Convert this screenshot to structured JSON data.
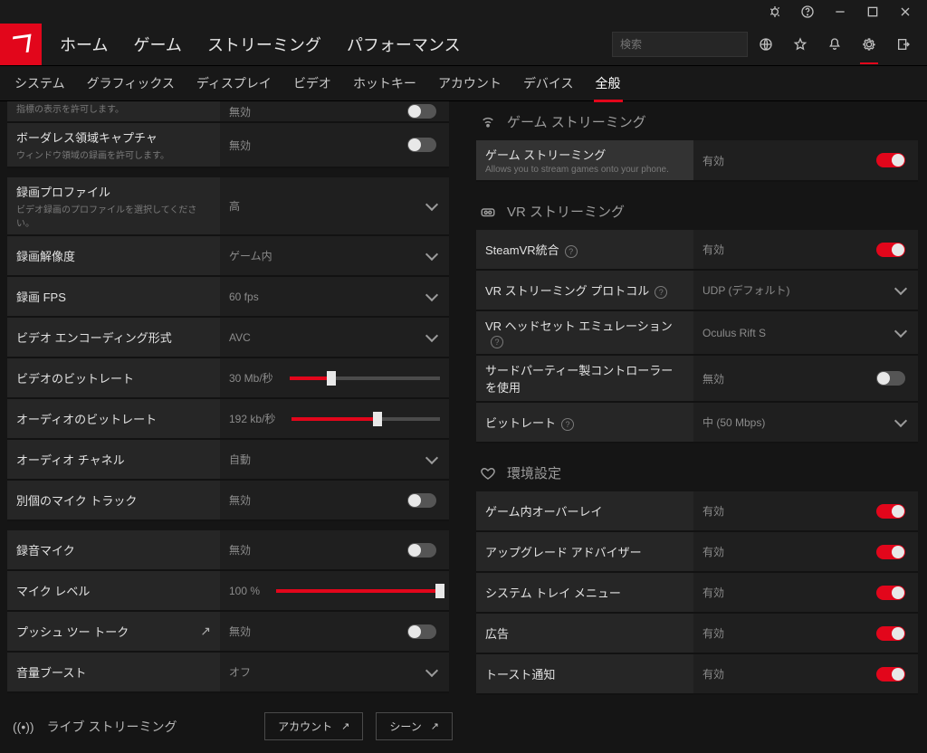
{
  "titlebar": {},
  "header": {
    "nav": [
      "ホーム",
      "ゲーム",
      "ストリーミング",
      "パフォーマンス"
    ],
    "search_placeholder": "検索"
  },
  "subtabs": {
    "items": [
      "システム",
      "グラフィックス",
      "ディスプレイ",
      "ビデオ",
      "ホットキー",
      "アカウント",
      "デバイス",
      "全般"
    ],
    "active_index": 7
  },
  "left": {
    "rows": [
      {
        "title": "",
        "sub": "指標の表示を許可します。",
        "value": "無効",
        "kind": "toggle",
        "on": false
      },
      {
        "title": "ボーダレス領域キャプチャ",
        "sub": "ウィンドウ領域の録画を許可します。",
        "value": "無効",
        "kind": "toggle",
        "on": false
      },
      {
        "title": "録画プロファイル",
        "sub": "ビデオ録画のプロファイルを選択してください。",
        "value": "高",
        "kind": "dropdown"
      },
      {
        "title": "録画解像度",
        "value": "ゲーム内",
        "kind": "dropdown"
      },
      {
        "title": "録画 FPS",
        "value": "60 fps",
        "kind": "dropdown"
      },
      {
        "title": "ビデオ エンコーディング形式",
        "value": "AVC",
        "kind": "dropdown"
      },
      {
        "title": "ビデオのビットレート",
        "value": "30 Mb/秒",
        "kind": "slider",
        "pct": 28
      },
      {
        "title": "オーディオのビットレート",
        "value": "192 kb/秒",
        "kind": "slider",
        "pct": 58
      },
      {
        "title": "オーディオ チャネル",
        "value": "自動",
        "kind": "dropdown"
      },
      {
        "title": "別個のマイク トラック",
        "value": "無効",
        "kind": "toggle",
        "on": false
      },
      {
        "title": "録音マイク",
        "value": "無効",
        "kind": "toggle",
        "on": false
      },
      {
        "title": "マイク レベル",
        "value": "100 %",
        "kind": "slider",
        "pct": 100
      },
      {
        "title": "プッシュ ツー トーク",
        "value": "無効",
        "kind": "toggle",
        "on": false,
        "share": true
      },
      {
        "title": "音量ブースト",
        "value": "オフ",
        "kind": "dropdown"
      }
    ],
    "livebar": {
      "title": "ライブ ストリーミング",
      "btn1": "アカウント",
      "btn2": "シーン"
    }
  },
  "right": {
    "sec_game": "ゲーム ストリーミング",
    "game_rows": [
      {
        "title": "ゲーム ストリーミング",
        "sub": "Allows you to stream games onto your phone.",
        "value": "有効",
        "kind": "toggle",
        "on": true,
        "highlight": true
      }
    ],
    "sec_vr": "VR ストリーミング",
    "vr_rows": [
      {
        "title": "SteamVR統合",
        "help": true,
        "value": "有効",
        "kind": "toggle",
        "on": true
      },
      {
        "title": "VR ストリーミング プロトコル",
        "help": true,
        "value": "UDP (デフォルト)",
        "kind": "dropdown"
      },
      {
        "title": "VR ヘッドセット エミュレーション",
        "help": true,
        "value": "Oculus Rift S",
        "kind": "dropdown"
      },
      {
        "title": "サードパーティー製コントローラーを使用",
        "value": "無効",
        "kind": "toggle",
        "on": false
      },
      {
        "title": "ビットレート",
        "help": true,
        "value": "中 (50 Mbps)",
        "kind": "dropdown"
      }
    ],
    "sec_pref": "環境設定",
    "pref_rows": [
      {
        "title": "ゲーム内オーバーレイ",
        "value": "有効",
        "kind": "toggle",
        "on": true
      },
      {
        "title": "アップグレード アドバイザー",
        "value": "有効",
        "kind": "toggle",
        "on": true
      },
      {
        "title": "システム トレイ メニュー",
        "value": "有効",
        "kind": "toggle",
        "on": true
      },
      {
        "title": "広告",
        "value": "有効",
        "kind": "toggle",
        "on": true
      },
      {
        "title": "トースト通知",
        "value": "有効",
        "kind": "toggle",
        "on": true
      }
    ]
  }
}
